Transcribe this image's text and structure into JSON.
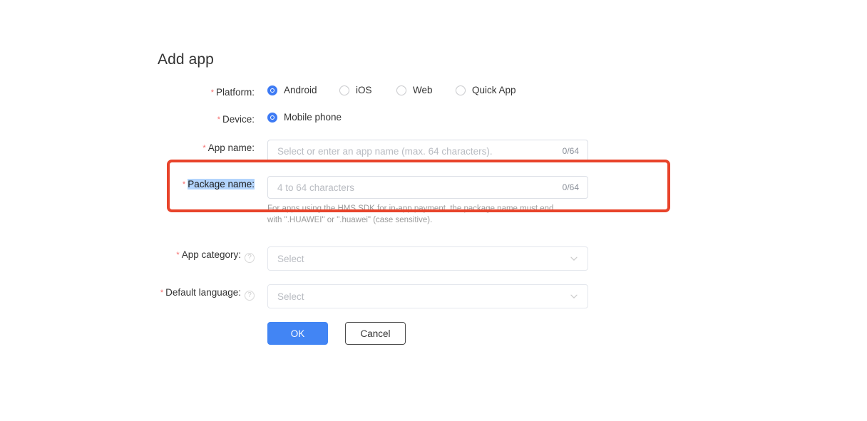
{
  "page": {
    "title": "Add app"
  },
  "form": {
    "platform": {
      "label": "Platform:",
      "required": true,
      "options": [
        {
          "label": "Android",
          "selected": true
        },
        {
          "label": "iOS",
          "selected": false
        },
        {
          "label": "Web",
          "selected": false
        },
        {
          "label": "Quick App",
          "selected": false
        }
      ]
    },
    "device": {
      "label": "Device:",
      "required": true,
      "options": [
        {
          "label": "Mobile phone",
          "selected": true
        }
      ]
    },
    "app_name": {
      "label": "App name:",
      "required": true,
      "value": "",
      "placeholder": "Select or enter an app name (max. 64 characters).",
      "counter": "0/64"
    },
    "package_name": {
      "label": "Package name:",
      "required": true,
      "label_selected": true,
      "value": "",
      "placeholder": "4 to 64 characters",
      "counter": "0/64",
      "helper_text": "For apps using the HMS SDK for in-app payment, the package name must end with \".HUAWEI\" or \".huawei\" (case sensitive)."
    },
    "app_category": {
      "label": "App category:",
      "required": true,
      "help_icon": "question-mark-icon",
      "value": "Select"
    },
    "default_language": {
      "label": "Default language:",
      "required": true,
      "help_icon": "question-mark-icon",
      "value": "Select"
    },
    "buttons": {
      "ok": "OK",
      "cancel": "Cancel"
    }
  },
  "annotation": {
    "shape": "rectangle",
    "target": "package-name-row",
    "color": "#e8432a"
  },
  "colors": {
    "accent": "#4285f4",
    "radio_checked": "#3e7bf4",
    "required_star": "#f56c6c",
    "annotation": "#e8432a",
    "selection_highlight": "#b3d4fc",
    "placeholder": "#b9bcc2",
    "helper_text": "#9a9a9a",
    "input_border": "#dcdfe6",
    "title_text": "#333333"
  }
}
